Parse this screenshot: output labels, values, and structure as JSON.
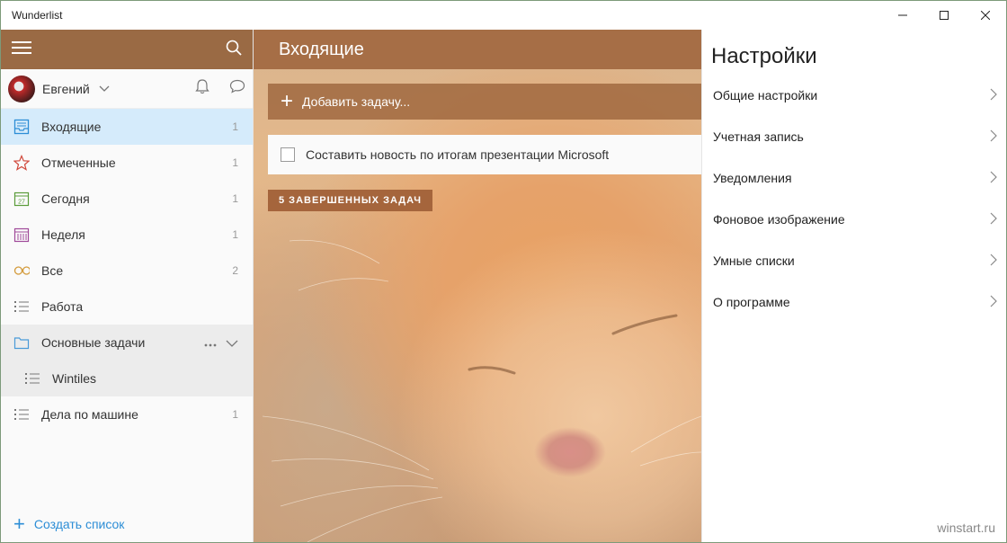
{
  "app": {
    "title": "Wunderlist"
  },
  "user": {
    "name": "Евгений"
  },
  "sidebar": {
    "items": [
      {
        "label": "Входящие",
        "count": "1"
      },
      {
        "label": "Отмеченные",
        "count": "1"
      },
      {
        "label": "Сегодня",
        "count": "1"
      },
      {
        "label": "Неделя",
        "count": "1"
      },
      {
        "label": "Все",
        "count": "2"
      },
      {
        "label": "Работа",
        "count": ""
      },
      {
        "label": "Основные задачи",
        "count": ""
      },
      {
        "label": "Wintiles",
        "count": ""
      },
      {
        "label": "Дела по машине",
        "count": "1"
      }
    ],
    "create_list_label": "Создать список",
    "calendar_day": "27"
  },
  "main": {
    "title": "Входящие",
    "add_task_label": "Добавить задачу...",
    "tasks": [
      {
        "title": "Составить новость по итогам презентации Microsoft",
        "completed": false
      }
    ],
    "completed_badge": "5 ЗАВЕРШЕННЫХ ЗАДАЧ"
  },
  "settings": {
    "title": "Настройки",
    "items": [
      "Общие настройки",
      "Учетная запись",
      "Уведомления",
      "Фоновое изображение",
      "Умные списки",
      "О программе"
    ]
  },
  "watermark": "winstart.ru",
  "colors": {
    "header_brown": "#9a6a44",
    "active_item": "#d5ebfb",
    "accent_blue": "#2d8ed6",
    "badge_brown": "#a5653c"
  }
}
